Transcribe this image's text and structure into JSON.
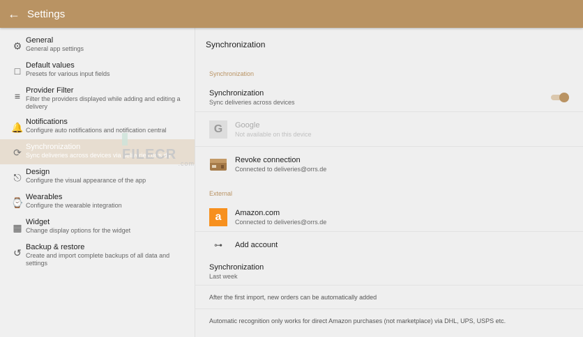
{
  "header": {
    "title": "Settings",
    "back_icon": "arrow-left-icon"
  },
  "sidebar": {
    "items": [
      {
        "label": "General",
        "desc": "General app settings",
        "icon": "gear-icon"
      },
      {
        "label": "Default values",
        "desc": "Presets for various input fields",
        "icon": "bookmark-icon"
      },
      {
        "label": "Provider Filter",
        "desc": "Filter the providers displayed while adding and editing a delivery",
        "icon": "filter-icon"
      },
      {
        "label": "Notifications",
        "desc": "Configure auto notifications and notification central",
        "icon": "bell-icon"
      },
      {
        "label": "Synchronization",
        "desc": "Sync deliveries across devices via deliveries.orrs.de",
        "icon": "sync-icon"
      },
      {
        "label": "Design",
        "desc": "Configure the visual appearance of the app",
        "icon": "paint-roller-icon"
      },
      {
        "label": "Wearables",
        "desc": "Configure the wearable integration",
        "icon": "watch-icon"
      },
      {
        "label": "Widget",
        "desc": "Change display options for the widget",
        "icon": "widget-icon"
      },
      {
        "label": "Backup & restore",
        "desc": "Create and import complete backups of all data and settings",
        "icon": "restore-icon"
      }
    ]
  },
  "watermark": {
    "text": "FILECR",
    "suffix": ".com"
  },
  "main": {
    "title": "Synchronization",
    "section_sync": "Synchronization",
    "sync_toggle": {
      "label": "Synchronization",
      "desc": "Sync deliveries across devices",
      "on": true
    },
    "google": {
      "label": "Google",
      "desc": "Not available on this device",
      "letter": "G"
    },
    "revoke": {
      "label": "Revoke connection",
      "desc": "Connected to deliveries@orrs.de"
    },
    "section_external": "External",
    "amazon": {
      "label": "Amazon.com",
      "desc": "Connected to deliveries@orrs.de",
      "letter": "a"
    },
    "add_account": "Add account",
    "sync_period": {
      "label": "Synchronization",
      "value": "Last week"
    },
    "note1": "After the first import, new orders can be automatically added",
    "note2": "Automatic recognition only works for direct Amazon purchases (not marketplace) via DHL, UPS, USPS etc."
  },
  "colors": {
    "accent": "#b99363",
    "amazon": "#f7901e"
  }
}
